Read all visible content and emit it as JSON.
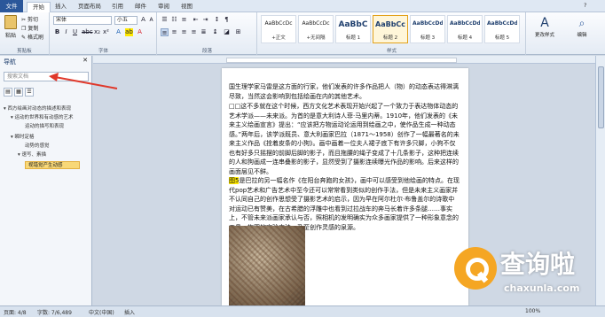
{
  "ribbon": {
    "tabs": [
      "文件",
      "开始",
      "插入",
      "页面布局",
      "引用",
      "邮件",
      "审阅",
      "视图"
    ],
    "clipboard": {
      "paste": "粘贴",
      "cut": "剪切",
      "copy": "复制",
      "format_painter": "格式刷",
      "label": "剪贴板"
    },
    "font": {
      "name": "宋体",
      "size": "小五",
      "label": "字体"
    },
    "paragraph": {
      "label": "段落"
    },
    "styles": {
      "label": "样式",
      "items": [
        {
          "sample": "AaBbCcDc",
          "name": "+正文"
        },
        {
          "sample": "AaBbCcDc",
          "name": "+无间隔"
        },
        {
          "sample": "AaBbC",
          "name": "标题 1"
        },
        {
          "sample": "AaBbCc",
          "name": "标题 2"
        },
        {
          "sample": "AaBbCcDd",
          "name": "标题 3"
        },
        {
          "sample": "AaBbCcDd",
          "name": "标题 4"
        },
        {
          "sample": "AaBbCcDd",
          "name": "标题 5"
        }
      ],
      "change_styles": "更改样式",
      "editing": "编辑"
    }
  },
  "nav": {
    "title": "导航",
    "search_placeholder": "搜索文档",
    "items": [
      "西方绘画对动态的描述和表现",
      "运动的世界和有动感的艺术",
      "运动的描写和表现",
      "瞬时定格",
      "动势的感觉",
      "速写、素描",
      "视错觉产生动感"
    ]
  },
  "document": {
    "paragraphs": [
      "国生理学家马雷是这方面的行家，他们发表的许多作品把人（物）的动态表达得淋漓尽致，当然这会影响到包括绘画在内的其他艺术。",
      "□□这不多就在这个时候，西方文化艺术表现开始兴起了一个致力于表达物体动态的艺术学派——未来派。为首的是意大利诗人菲·马里内蒂。1910年，他们发表的《未来主义绘画宣言》提出：“应该把方物运动论运用到绘画之中，使作品生成一种动态感。”两年后，该学派既员、意大利画家巴拉（1871～1958）创作了一幅最著名的未来主义作品《拴着皮条的小狗》。画中画着一位夫人裙子底下有许多只脚，小狗不仅也有好多只摇摆的前脚后脚的影子，而且拖腰的绳子变成了十几条影子，这种把连续的人和狗画成一连串叠影的影子，显然受到了摄影连续曝光作品的影响。后来这样的画面层见不鲜。",
      "图5是巴拉的另一幅名作《在阳台奔跑的女孩》，画中可以感受到他绘画的特点。在现代pop艺术和广告艺术中至今还可以常常看到类似的创作手法，但是未来主义画家并不认同自己的创作思想受了摄影艺术的启示，因为早在阿尔杜尔·布鲁盖尔的诗歌中对运动已有赞美，在古希腊的浮雕中也看到过拉战车的奔马长着许多条腿……事实上，不管未来派画家承认与否，照相机的发明确实为众多画家提供了一种形象意念的工具，构图的实验方法，乃至创作灵感的泉源。"
    ],
    "highlight_word": "图5"
  },
  "status": {
    "page": "页面: 4/8",
    "words": "字数: 7/6,489",
    "language": "中文(中国)",
    "mode": "插入",
    "zoom": "100%"
  },
  "watermark": {
    "text": "查询啦",
    "url": "chaxunla.com"
  },
  "colors": {
    "file_tab": "#2b579a",
    "highlight": "#ffe800",
    "nav_selected": "#f8d878",
    "arrow": "#e0382a"
  }
}
